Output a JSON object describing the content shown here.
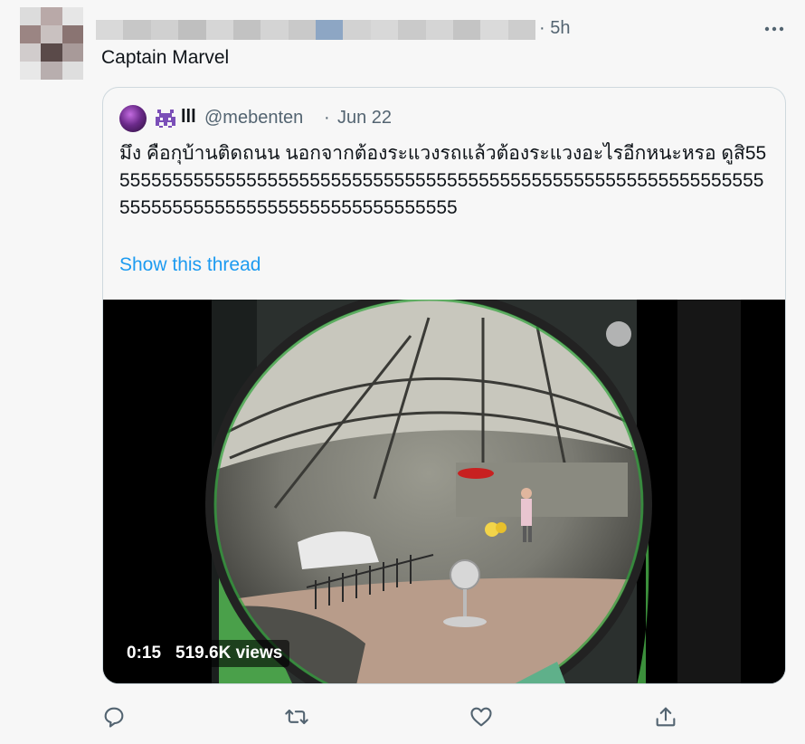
{
  "tweet": {
    "timestamp": "· 5h",
    "text": "Captain Marvel",
    "more_icon": "more-horizontal-icon"
  },
  "quote": {
    "emoji": "alien-monster-icon",
    "name_bars": "lll",
    "handle": "@mebenten",
    "dot": "·",
    "date": "Jun 22",
    "text": "มึง คือกุบ้านติดถนน นอกจากต้องระแวงรถแล้วต้องระแวงอะไรอีกหนะหรอ ดูสิ55555555555555555555555555555555555555555555555555555555555555555555555555555555555555555555555",
    "show_thread": "Show this thread",
    "video": {
      "duration": "0:15",
      "views": "519.6K views"
    }
  },
  "actions": {
    "reply_icon": "reply-icon",
    "retweet_icon": "retweet-icon",
    "like_icon": "like-icon",
    "share_icon": "share-icon"
  },
  "colors": {
    "link": "#1d9bf0",
    "muted": "#536471",
    "border": "#cfd9de"
  }
}
